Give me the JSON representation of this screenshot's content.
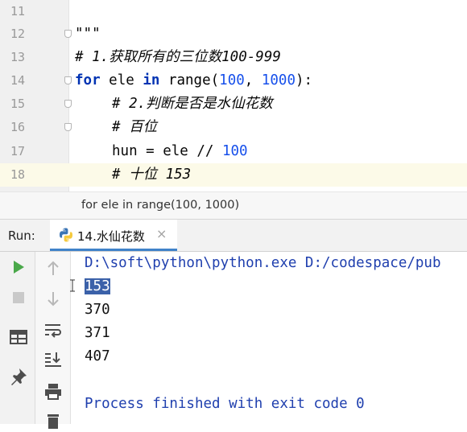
{
  "editor": {
    "lines": [
      {
        "num": "11"
      },
      {
        "num": "12",
        "text": "\"\"\""
      },
      {
        "num": "13",
        "comment": "# 1.获取所有的三位数100-999"
      },
      {
        "num": "14",
        "kw_for": "for",
        "var": "ele",
        "kw_in": "in",
        "func": "range",
        "arg1": "100",
        "arg2": "1000"
      },
      {
        "num": "15",
        "comment": "# 2.判断是否是水仙花数"
      },
      {
        "num": "16",
        "comment": "# 百位"
      },
      {
        "num": "17",
        "lhs": "hun = ele // ",
        "rhs": "100"
      },
      {
        "num": "18",
        "comment": "# 十位 153"
      }
    ]
  },
  "breadcrumb": "for ele in range(100, 1000)",
  "run_panel": {
    "label": "Run:",
    "tab_title": "14.水仙花数",
    "tab_close": "×"
  },
  "console": {
    "command": "D:\\soft\\python\\python.exe D:/codespace/pub",
    "outputs": [
      "153",
      "370",
      "371",
      "407"
    ],
    "exit_message": "Process finished with exit code 0"
  },
  "colors": {
    "keyword": "#0033b3",
    "number": "#1750eb",
    "comment": "#8c8c8c",
    "current_line": "#fcfae8",
    "selection": "#3b61a9",
    "run_green": "#4aa84a",
    "tab_underline": "#4083c9"
  },
  "icons": [
    "run-icon",
    "stop-icon",
    "layout-icon",
    "pin-icon",
    "up-arrow-icon",
    "down-arrow-icon",
    "soft-wrap-icon",
    "scroll-to-end-icon",
    "print-icon",
    "trash-icon",
    "python-icon",
    "close-icon"
  ]
}
